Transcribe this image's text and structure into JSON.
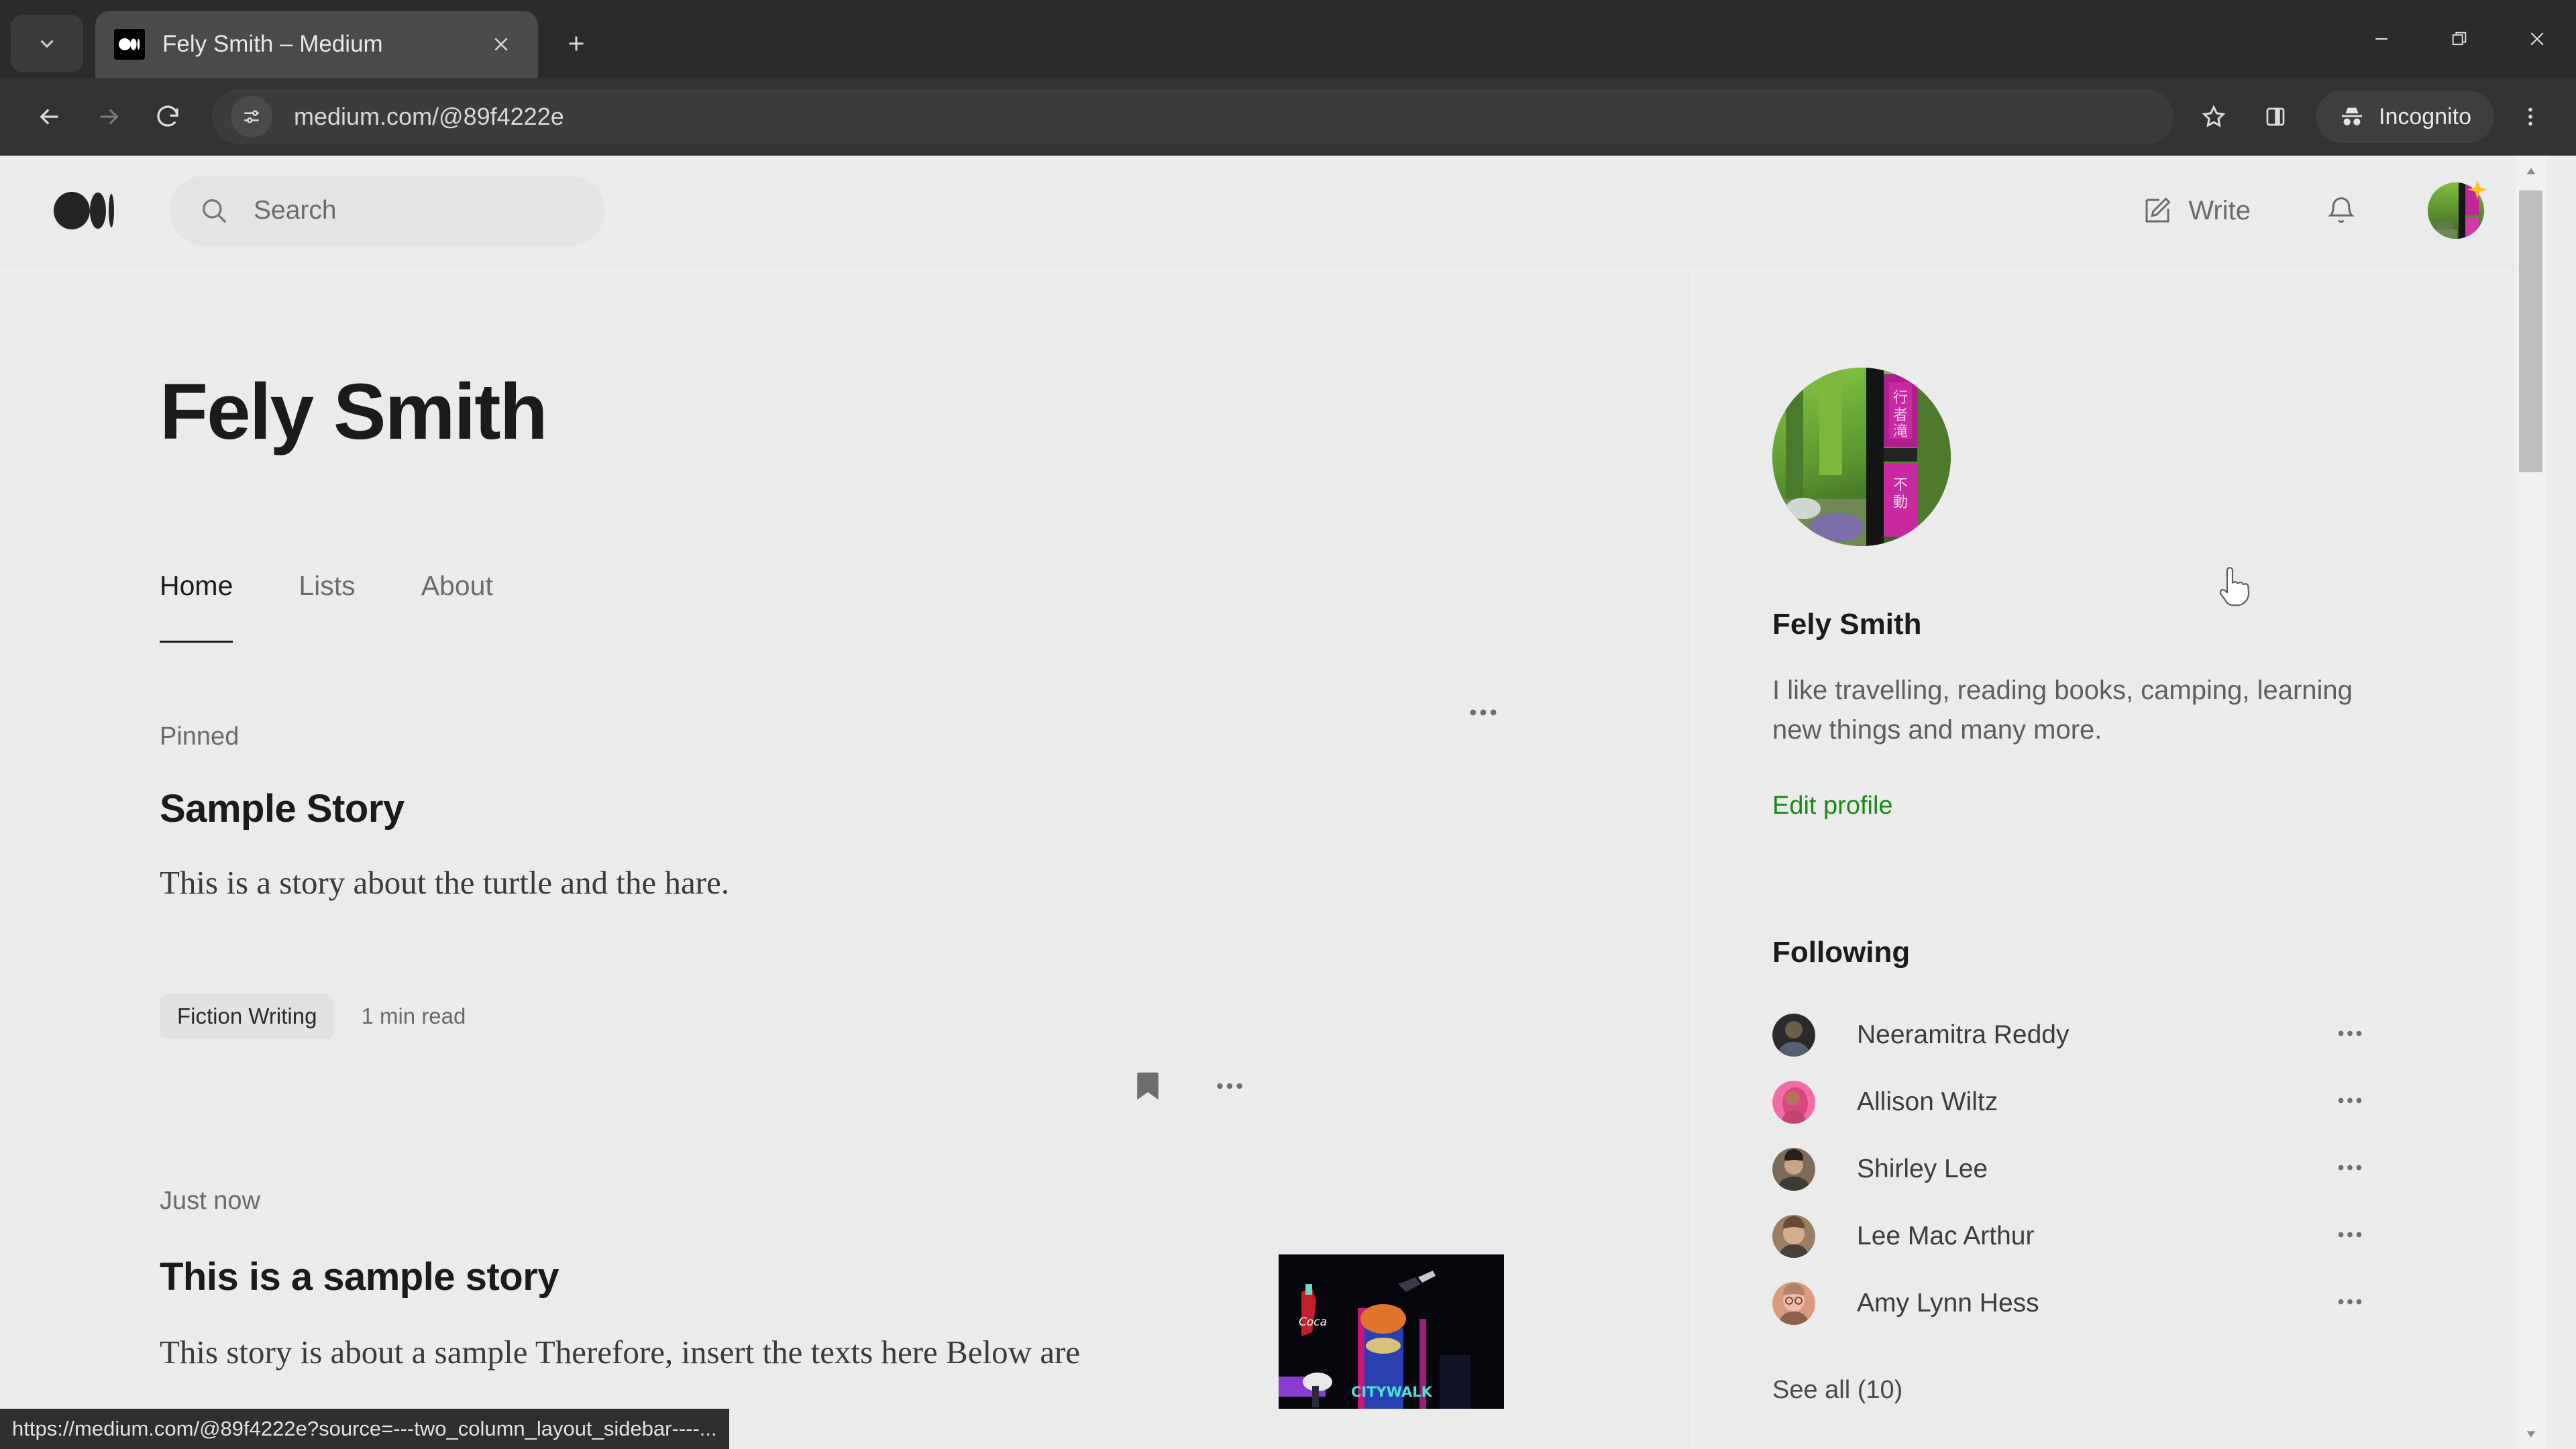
{
  "browser": {
    "tab": {
      "title": "Fely Smith – Medium",
      "favicon": "medium-logo-icon"
    },
    "tab_list_icon": "chevron-down-icon",
    "new_tab_icon": "plus-icon",
    "window_controls": {
      "minimize": "minimize-icon",
      "maximize": "maximize-icon",
      "close": "close-icon"
    },
    "back_icon": "arrow-left-icon",
    "forward_icon": "arrow-right-icon",
    "reload_icon": "reload-icon",
    "site_info_icon": "tune-icon",
    "url": "medium.com/@89f4222e",
    "bookmark_icon": "star-icon",
    "split_view_icon": "side-panel-icon",
    "incognito_label": "Incognito",
    "incognito_icon": "incognito-icon",
    "menu_icon": "kebab-menu-icon"
  },
  "status_bar": {
    "url": "https://medium.com/@89f4222e?source=---two_column_layout_sidebar----..."
  },
  "site_header": {
    "logo_icon": "medium-logo-icon",
    "search": {
      "placeholder": "Search",
      "icon": "search-icon"
    },
    "write": {
      "label": "Write",
      "icon": "write-pencil-icon"
    },
    "notifications_icon": "bell-icon",
    "avatar_icon": "user-avatar",
    "avatar_badge_icon": "star-badge-icon"
  },
  "profile": {
    "name": "Fely Smith",
    "more_icon": "ellipsis-icon",
    "tabs": [
      {
        "label": "Home",
        "active": true
      },
      {
        "label": "Lists",
        "active": false
      },
      {
        "label": "About",
        "active": false
      }
    ]
  },
  "stories": [
    {
      "kicker": "Pinned",
      "title": "Sample Story",
      "subtitle": "This is a story about the turtle and the hare.",
      "tag": "Fiction Writing",
      "read_time": "1 min read",
      "bookmark_icon": "bookmark-filled-icon",
      "more_icon": "ellipsis-icon"
    },
    {
      "kicker": "Just now",
      "title": "This is a sample story",
      "subtitle": "This story is about a sample Therefore, insert the texts here Below are",
      "thumbnail_alt": "night-city-neon-photo"
    }
  ],
  "sidebar": {
    "avatar_icon": "user-avatar-large",
    "name": "Fely Smith",
    "bio": "I like travelling, reading books, camping, learning new things and many more.",
    "edit_profile": "Edit profile",
    "edit_profile_color": "#1a8917",
    "following_heading": "Following",
    "following": [
      {
        "name": "Neeramitra Reddy",
        "more_icon": "ellipsis-icon",
        "avatar_c1": "#3a3a3a",
        "avatar_c2": "#6d6152"
      },
      {
        "name": "Allison Wiltz",
        "more_icon": "ellipsis-icon",
        "avatar_c1": "#f06ba8",
        "avatar_c2": "#c2456f"
      },
      {
        "name": "Shirley Lee",
        "more_icon": "ellipsis-icon",
        "avatar_c1": "#8a7a68",
        "avatar_c2": "#4b3f33"
      },
      {
        "name": "Lee Mac Arthur",
        "more_icon": "ellipsis-icon",
        "avatar_c1": "#a88a6e",
        "avatar_c2": "#6a4b35"
      },
      {
        "name": "Amy Lynn Hess",
        "more_icon": "ellipsis-icon",
        "avatar_c1": "#e0a38c",
        "avatar_c2": "#b56b53"
      }
    ],
    "see_all": "See all (10)"
  },
  "scrollbar": {
    "up_icon": "triangle-up-icon",
    "down_icon": "triangle-down-icon"
  },
  "cursor": {
    "icon": "pointer-hand-cursor"
  }
}
